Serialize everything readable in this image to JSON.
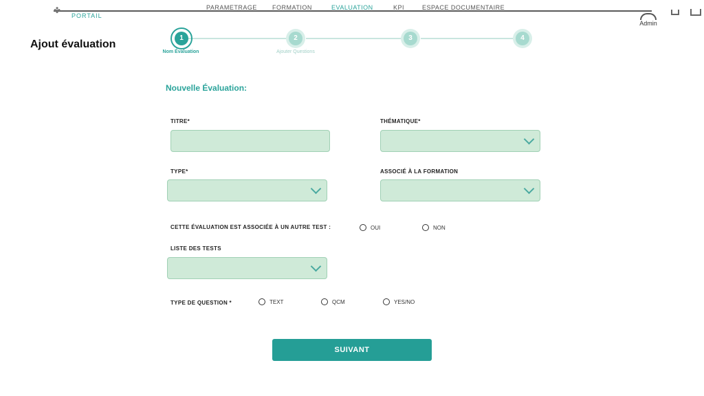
{
  "header": {
    "logo_text": "PORTAIL",
    "nav": [
      "PARAMETRAGE",
      "FORMATION",
      "EVALUATION",
      "KPI",
      "ESPACE DOCUMENTAIRE"
    ],
    "user_label": "Admin"
  },
  "page_title": "Ajout évaluation",
  "stepper": {
    "steps": [
      {
        "number": "1",
        "label": "Nom Évaluation",
        "active": true
      },
      {
        "number": "2",
        "label": "Ajouter Questions",
        "active": false
      },
      {
        "number": "3",
        "label": "",
        "active": false
      },
      {
        "number": "4",
        "label": "",
        "active": false
      }
    ]
  },
  "form": {
    "section_title": "Nouvelle Évaluation:",
    "titre_label": "TITRE*",
    "thematique_label": "THÉMATIQUE*",
    "type_label": "TYPE*",
    "formation_label": "ASSOCIÉ À LA FORMATION",
    "assoc_test_label": "CETTE ÉVALUATION EST ASSOCIÉE À UN AUTRE TEST :",
    "assoc_options": [
      "OUI",
      "NON"
    ],
    "liste_tests_label": "LISTE DES TESTS",
    "question_type_label": "TYPE DE QUESTION *",
    "question_type_options": [
      "TEXT",
      "QCM",
      "YES/NO"
    ],
    "submit_label": "SUIVANT"
  },
  "colors": {
    "accent": "#2aa39a",
    "input_bg": "#cfead8",
    "button_bg": "#259e96"
  }
}
